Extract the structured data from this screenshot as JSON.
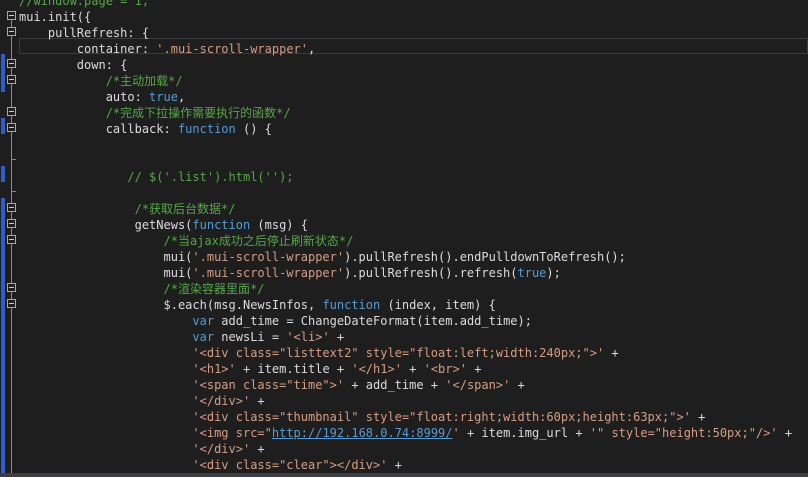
{
  "code": {
    "lines": [
      "//window.page = 1;",
      "mui.init({",
      "    pullRefresh: {",
      "        container: '.mui-scroll-wrapper',",
      "        down: {",
      "            /*主动加载*/",
      "            auto: true,",
      "            /*完成下拉操作需要执行的函数*/",
      "            callback: function () {",
      "",
      "",
      "               // $('.list').html('');",
      "",
      "                /*获取后台数据*/",
      "                getNews(function (msg) {",
      "                    /*当ajax成功之后停止刷新状态*/",
      "                    mui('.mui-scroll-wrapper').pullRefresh().endPulldownToRefresh();",
      "                    mui('.mui-scroll-wrapper').pullRefresh().refresh(true);",
      "                    /*渲染容器里面*/",
      "                    $.each(msg.NewsInfos, function (index, item) {",
      "                        var add_time = ChangeDateFormat(item.add_time);",
      "                        var newsLi = '<li>' +",
      "                        '<div class=\"listtext2\" style=\"float:left;width:240px;\">' +",
      "                        '<h1>' + item.title + '</h1>' + '<br>' +",
      "                        '<span class=\"time\">' + add_time + '</span>' +",
      "                        '</div>' +",
      "                        '<div class=\"thumbnail\" style=\"float:right;width:60px;height:63px;\">' +",
      "                        '<img src=\"http://192.168.0.74:8999/' + item.img_url + '\" style=\"height:50px;\"/>' +",
      "                        '</div>' +",
      "                        '<div class=\"clear\"></div>' +"
    ],
    "url_text": "http://192.168.0.74:8999/"
  },
  "colors": {
    "background": "#1e1e1e",
    "comment": "#57a64a",
    "keyword": "#569cd6",
    "string": "#d69d85",
    "plain": "#dcdcdc",
    "change_bar": "#2a5fd4"
  }
}
